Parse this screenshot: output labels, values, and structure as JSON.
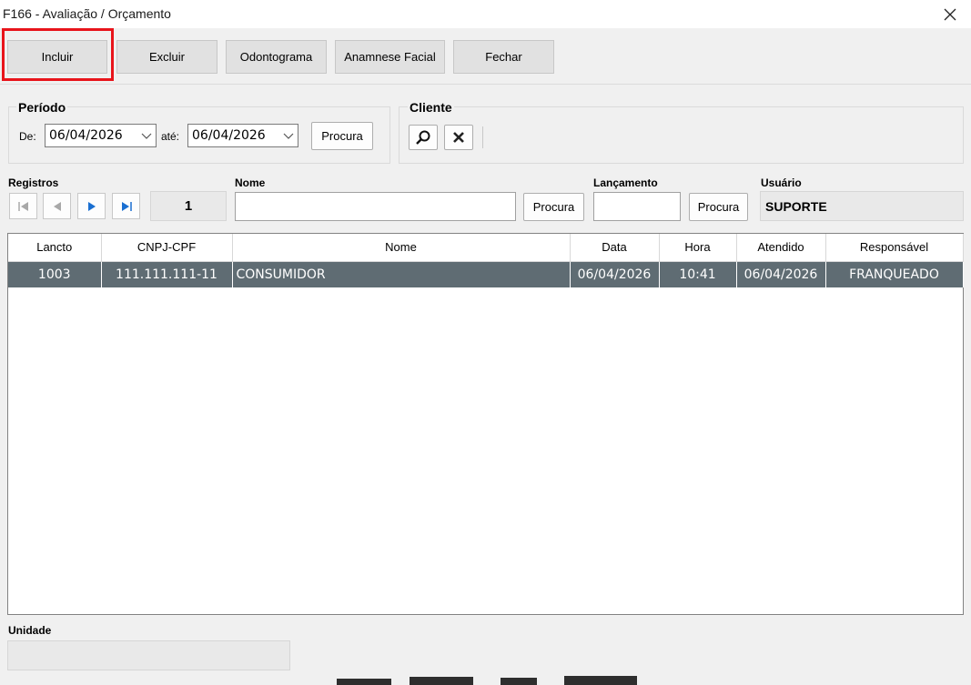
{
  "window": {
    "title": "F166 - Avaliação / Orçamento"
  },
  "toolbar": {
    "incluir": "Incluir",
    "excluir": "Excluir",
    "odontograma": "Odontograma",
    "anamnese": "Anamnese Facial",
    "fechar": "Fechar"
  },
  "periodo": {
    "title": "Período",
    "de_label": "De:",
    "de_value": "06/04/2026",
    "ate_label": "até:",
    "ate_value": "06/04/2026",
    "procura": "Procura"
  },
  "cliente": {
    "title": "Cliente"
  },
  "registros": {
    "label": "Registros",
    "current": "1"
  },
  "nome": {
    "label": "Nome",
    "value": "",
    "procura": "Procura"
  },
  "lancamento": {
    "label": "Lançamento",
    "value": "",
    "procura": "Procura"
  },
  "usuario": {
    "label": "Usuário",
    "value": "SUPORTE"
  },
  "grid": {
    "columns": [
      "Lancto",
      "CNPJ-CPF",
      "Nome",
      "Data",
      "Hora",
      "Atendido",
      "Responsável"
    ],
    "rows": [
      [
        "1003",
        "111.111.111-11",
        "CONSUMIDOR",
        "06/04/2026",
        "10:41",
        "06/04/2026",
        "FRANQUEADO"
      ]
    ]
  },
  "unidade": {
    "label": "Unidade",
    "value": ""
  },
  "colors": {
    "selected_row": "#5f6c73",
    "highlight": "#e8141b",
    "nav_blue": "#1a6fd1"
  }
}
